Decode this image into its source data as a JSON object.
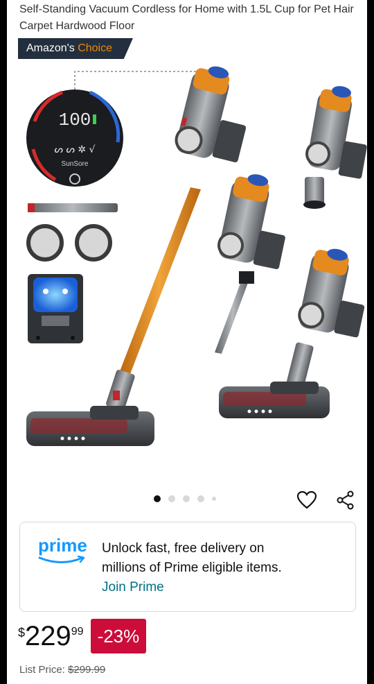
{
  "product": {
    "title": "Self-Standing Vacuum Cordless for Home with 1.5L Cup for Pet Hair Carpet Hardwood Floor",
    "badge_prefix": "Amazon's ",
    "badge_accent": "Choice",
    "image_alt": "Cordless stick vacuum with display and accessories",
    "display_brand": "SunSore",
    "display_reading": "100",
    "carousel": {
      "count": 5,
      "active_index": 0
    }
  },
  "actions": {
    "favorite_icon": "heart-icon",
    "share_icon": "share-icon"
  },
  "prime": {
    "logo_text": "prime",
    "message_line1": "Unlock fast, free delivery on",
    "message_line2": "millions of Prime eligible items.",
    "join_link": "Join Prime"
  },
  "price": {
    "symbol": "$",
    "whole": "229",
    "fraction": "99",
    "discount": "-23%",
    "list_label": "List Price:",
    "list_value": "$299.99"
  },
  "colors": {
    "navy": "#232f3e",
    "choice_orange": "#f08804",
    "prime_blue": "#1399ff",
    "link_teal": "#007185",
    "deal_red": "#cc0c39",
    "text": "#0f1111"
  }
}
